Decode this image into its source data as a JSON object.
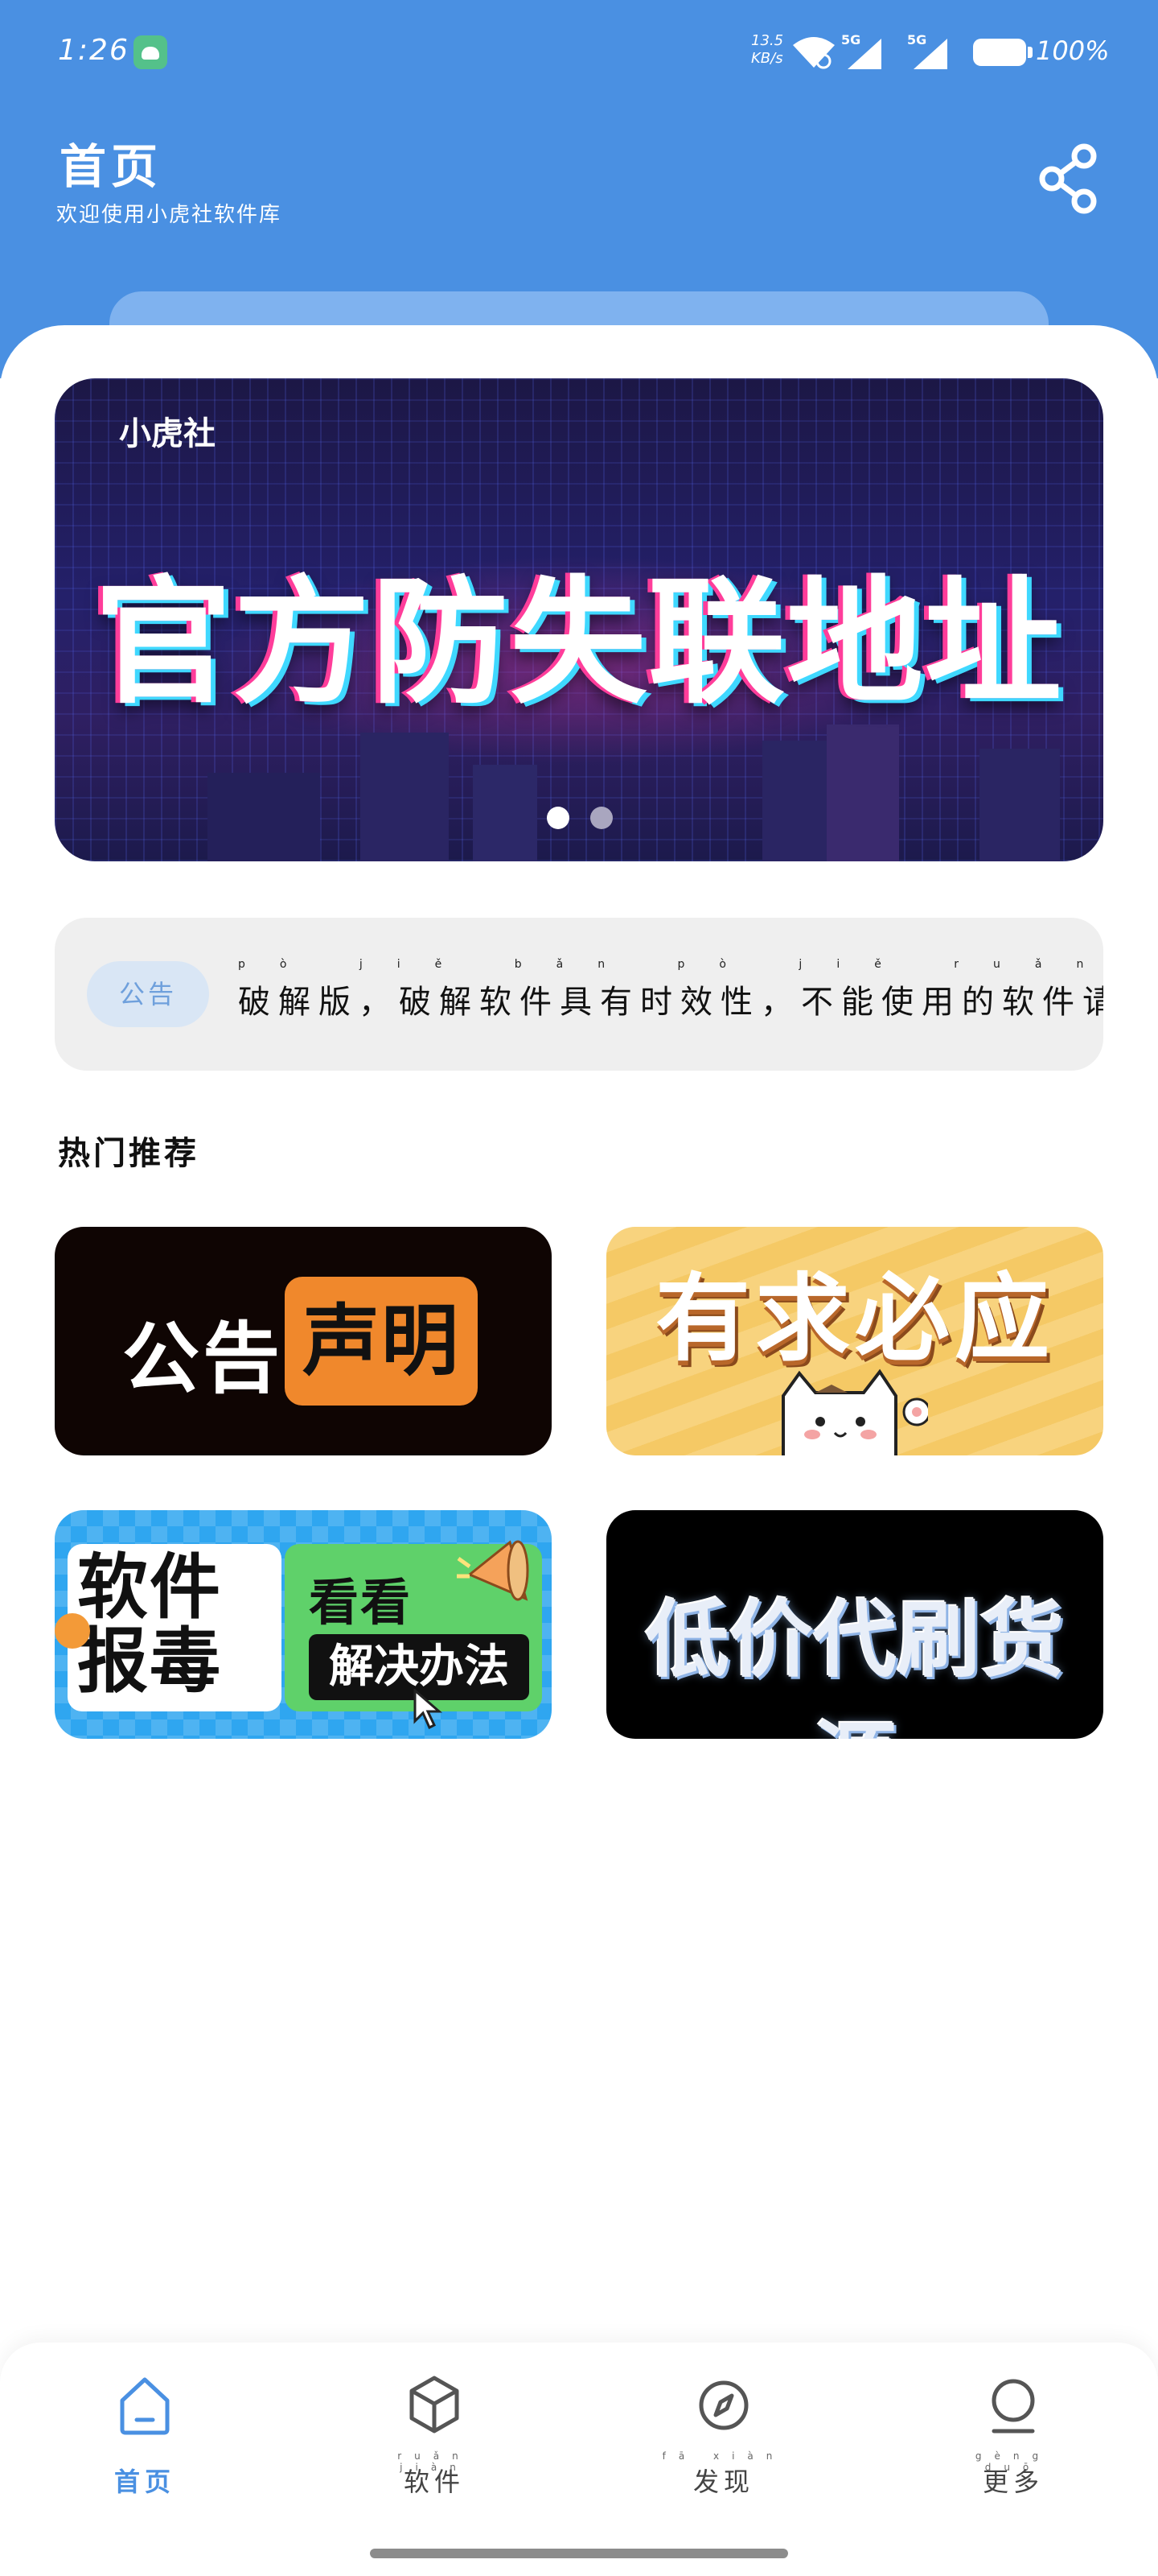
{
  "status_bar": {
    "time": "1:26",
    "net_speed_top": "13.5",
    "net_speed_unit": "KB/s",
    "signal1_label": "5G",
    "signal2_label": "5G",
    "battery": "100%"
  },
  "header": {
    "title": "首页",
    "subtitle": "欢迎使用小虎社软件库"
  },
  "banner": {
    "brand": "小虎社",
    "headline": "官方防失联地址",
    "page_count": 2,
    "active_page": 1
  },
  "notice": {
    "badge": "公告",
    "text": "破解版，破解软件具有时效性，不能使用的软件请到",
    "pinyin": "pò jiě bǎn pò jiě ruǎn jiàn jù yǒu shí xiào xìng bù néng shǐ yòng de ruǎn jiàn qǐng dào"
  },
  "section": {
    "title": "热门推荐"
  },
  "tiles": [
    {
      "part1": "公告",
      "part2": "声明"
    },
    {
      "title": "有求必应"
    },
    {
      "left": "软件报毒",
      "right_top": "看看",
      "right_bottom": "解决办法"
    },
    {
      "title": "低价代刷货源"
    }
  ],
  "nav": {
    "items": [
      {
        "label": "首页",
        "pinyin": "",
        "icon": "home-icon",
        "active": true
      },
      {
        "label": "软件",
        "pinyin": "ruǎn jiàn",
        "icon": "cube-icon",
        "active": false
      },
      {
        "label": "发现",
        "pinyin": "fā xiàn",
        "icon": "compass-icon",
        "active": false
      },
      {
        "label": "更多",
        "pinyin": "gèng duō",
        "icon": "user-icon",
        "active": false
      }
    ]
  },
  "colors": {
    "brand_blue": "#4a90e2",
    "notice_badge_text": "#6fa0dc",
    "tile_notice_orange": "#f0882c"
  }
}
